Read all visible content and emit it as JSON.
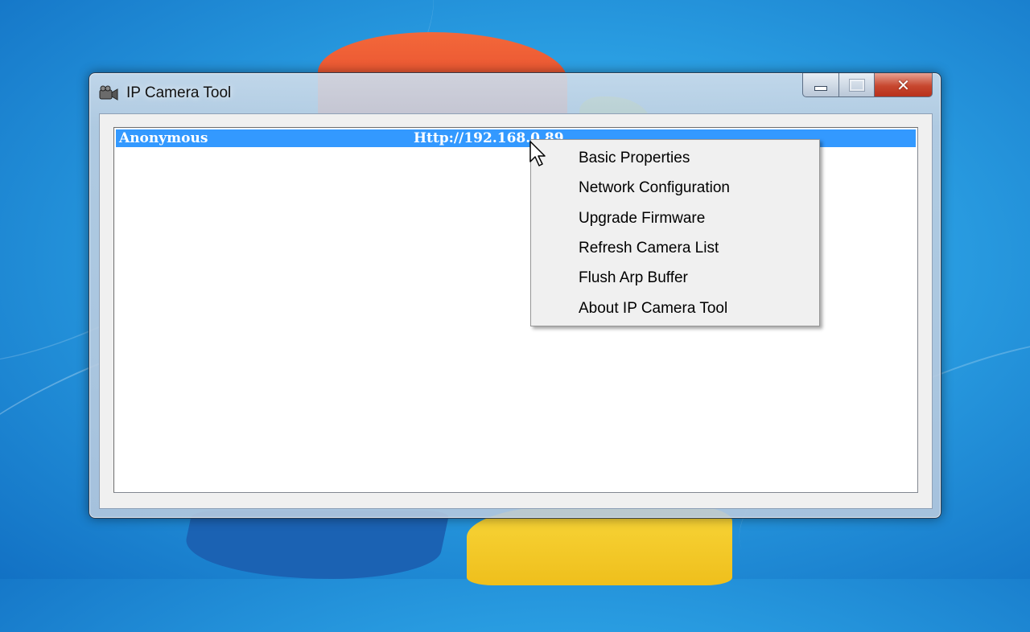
{
  "window": {
    "title": "IP Camera Tool",
    "icon": "camera-icon"
  },
  "caption": {
    "minimize_icon": "minimize-icon",
    "maximize_icon": "maximize-icon",
    "close_glyph": "✕"
  },
  "camera_list": {
    "rows": [
      {
        "name": "Anonymous",
        "url": "Http://192.168.0.89"
      }
    ]
  },
  "context_menu": {
    "items": [
      {
        "label": "Basic Properties"
      },
      {
        "label": "Network Configuration"
      },
      {
        "label": "Upgrade Firmware"
      },
      {
        "label": "Refresh Camera List"
      },
      {
        "label": "Flush Arp Buffer"
      },
      {
        "label": "About IP Camera Tool"
      }
    ]
  },
  "colors": {
    "selection": "#3399ff",
    "menu_background": "#f0f0f0",
    "close_button": "#c7472f"
  }
}
